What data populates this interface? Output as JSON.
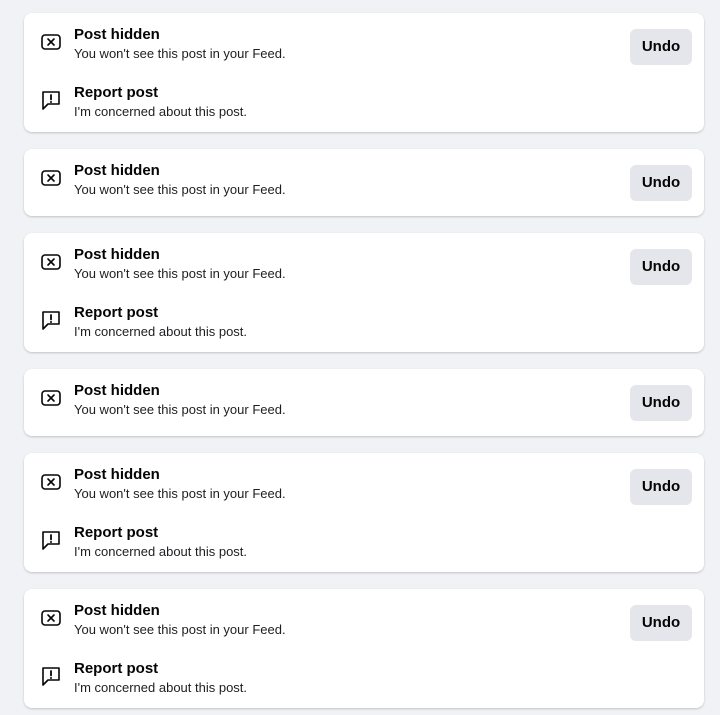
{
  "cards": [
    {
      "hidden_title": "Post hidden",
      "hidden_subtitle": "You won't see this post in your Feed.",
      "undo_label": "Undo",
      "report_title": "Report post",
      "report_subtitle": "I'm concerned about this post."
    },
    {
      "hidden_title": "Post hidden",
      "hidden_subtitle": "You won't see this post in your Feed.",
      "undo_label": "Undo"
    },
    {
      "hidden_title": "Post hidden",
      "hidden_subtitle": "You won't see this post in your Feed.",
      "undo_label": "Undo",
      "report_title": "Report post",
      "report_subtitle": "I'm concerned about this post."
    },
    {
      "hidden_title": "Post hidden",
      "hidden_subtitle": "You won't see this post in your Feed.",
      "undo_label": "Undo"
    },
    {
      "hidden_title": "Post hidden",
      "hidden_subtitle": "You won't see this post in your Feed.",
      "undo_label": "Undo",
      "report_title": "Report post",
      "report_subtitle": "I'm concerned about this post."
    },
    {
      "hidden_title": "Post hidden",
      "hidden_subtitle": "You won't see this post in your Feed.",
      "undo_label": "Undo",
      "report_title": "Report post",
      "report_subtitle": "I'm concerned about this post."
    }
  ],
  "icons": {
    "hidden": "close-box-icon",
    "report": "report-flag-icon"
  },
  "colors": {
    "background": "#f0f2f5",
    "card": "#ffffff",
    "button": "#e4e6eb",
    "text": "#050505"
  }
}
